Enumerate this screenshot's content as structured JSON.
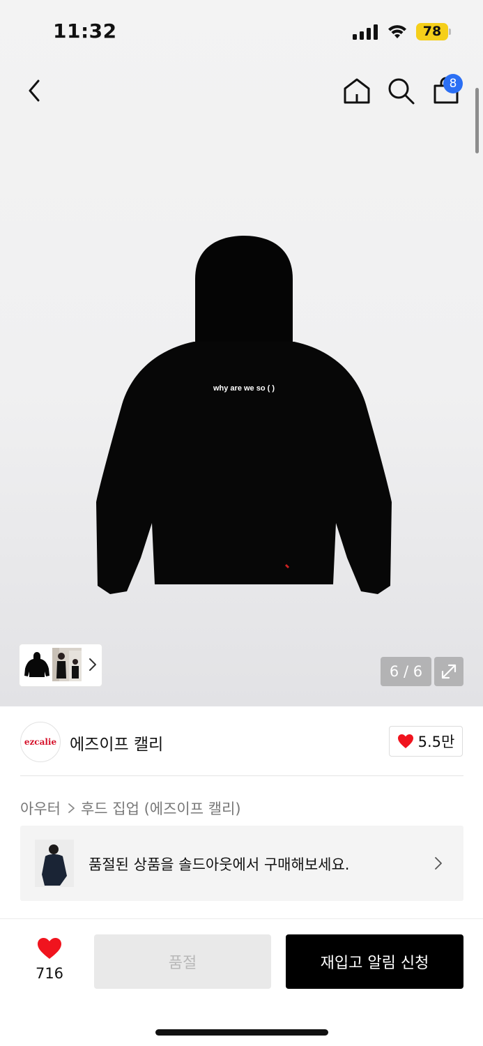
{
  "status_bar": {
    "time": "11:32",
    "battery": "78"
  },
  "header": {
    "cart_count": "8"
  },
  "product": {
    "print_text": "why are we so (    )",
    "image_counter": "6 / 6"
  },
  "brand": {
    "logo_text": "ezcalie",
    "name": "에즈이프 캘리",
    "likes": "5.5만"
  },
  "breadcrumb": {
    "category": "아우터",
    "subcategory": "후드 집업 (에즈이프 캘리)"
  },
  "soldout_banner": {
    "text": "품절된 상품을 솔드아웃에서 구매해보세요."
  },
  "bottom_bar": {
    "wish_count": "716",
    "soldout_label": "품절",
    "restock_label": "재입고 알림 신청"
  },
  "colors": {
    "accent_blue": "#2b6ff4",
    "heart_red": "#f0141e",
    "battery_yellow": "#f5cf1a"
  },
  "icons": [
    "back-icon",
    "home-icon",
    "search-icon",
    "cart-icon",
    "chevron-right-icon",
    "expand-icon",
    "heart-icon"
  ]
}
